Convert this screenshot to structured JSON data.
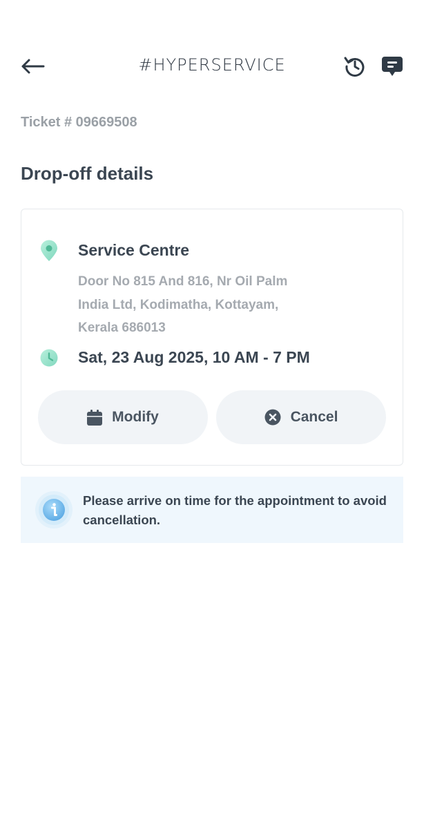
{
  "header": {
    "title": "#HYPERSERVICE",
    "back_icon": "arrow-left-icon",
    "refresh_icon": "history-icon",
    "chat_icon": "chat-icon"
  },
  "ticket": {
    "label": "Ticket # 09669508"
  },
  "section": {
    "title": "Drop-off details"
  },
  "dropoff": {
    "location_icon": "map-pin-icon",
    "location_name": "Service Centre",
    "address_lines": [
      "Door No 815 And 816, Nr Oil Palm",
      "India Ltd, Kodimatha, Kottayam,",
      "Kerala 686013"
    ],
    "schedule_icon": "clock-icon",
    "schedule": "Sat, 23 Aug 2025, 10 AM - 7 PM"
  },
  "actions": {
    "modify_label": "Modify",
    "modify_icon": "calendar-icon",
    "cancel_label": "Cancel",
    "cancel_icon": "close-circle-icon"
  },
  "notice": {
    "icon": "info-icon",
    "text": "Please arrive on time for the appointment to avoid cancellation."
  },
  "colors": {
    "text_primary": "#3b4652",
    "text_muted": "#a5aab0",
    "button_bg": "#f1f4f7",
    "notice_bg": "#eff7fd",
    "accent_teal": "#8fe0c8",
    "info_blue": "#7cc0ee"
  }
}
